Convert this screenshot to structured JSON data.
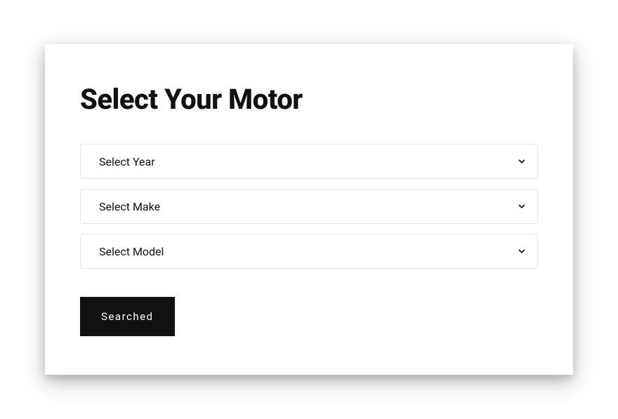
{
  "form": {
    "title": "Select Your Motor",
    "year": {
      "label": "Select Year"
    },
    "make": {
      "label": "Select Make"
    },
    "model": {
      "label": "Select Model"
    },
    "submit_label": "Searched"
  }
}
